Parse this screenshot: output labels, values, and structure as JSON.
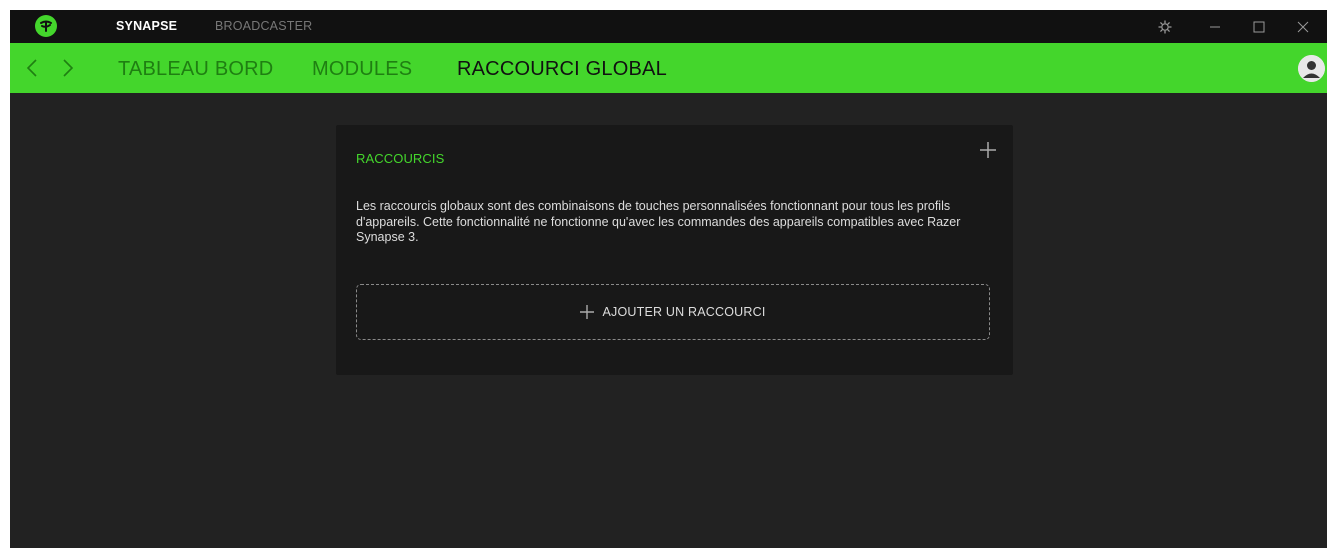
{
  "colors": {
    "accent": "#44d62c",
    "background": "#222222",
    "titlebar": "#111111",
    "card": "#181818"
  },
  "titlebar": {
    "logo_icon": "razer-snake-icon",
    "tabs": [
      {
        "label": "SYNAPSE",
        "active": true
      },
      {
        "label": "BROADCASTER",
        "active": false
      }
    ],
    "controls": [
      "settings-gear-icon",
      "minimize-icon",
      "maximize-icon",
      "close-icon"
    ]
  },
  "nav": {
    "back_icon": "chevron-left-icon",
    "forward_icon": "chevron-right-icon",
    "tabs": [
      {
        "label": "TABLEAU BORD",
        "active": false
      },
      {
        "label": "MODULES",
        "active": false
      },
      {
        "label": "RACCOURCI GLOBAL",
        "active": true
      }
    ],
    "avatar_icon": "user-avatar-icon"
  },
  "card": {
    "title": "RACCOURCIS",
    "add_icon": "plus-icon",
    "description": "Les raccourcis globaux sont des combinaisons de touches personnalisées fonctionnant pour tous les profils d'appareils. Cette fonctionnalité ne fonctionne qu'avec les commandes des appareils compatibles avec Razer Synapse 3.",
    "add_button_label": "AJOUTER UN RACCOURCI"
  }
}
